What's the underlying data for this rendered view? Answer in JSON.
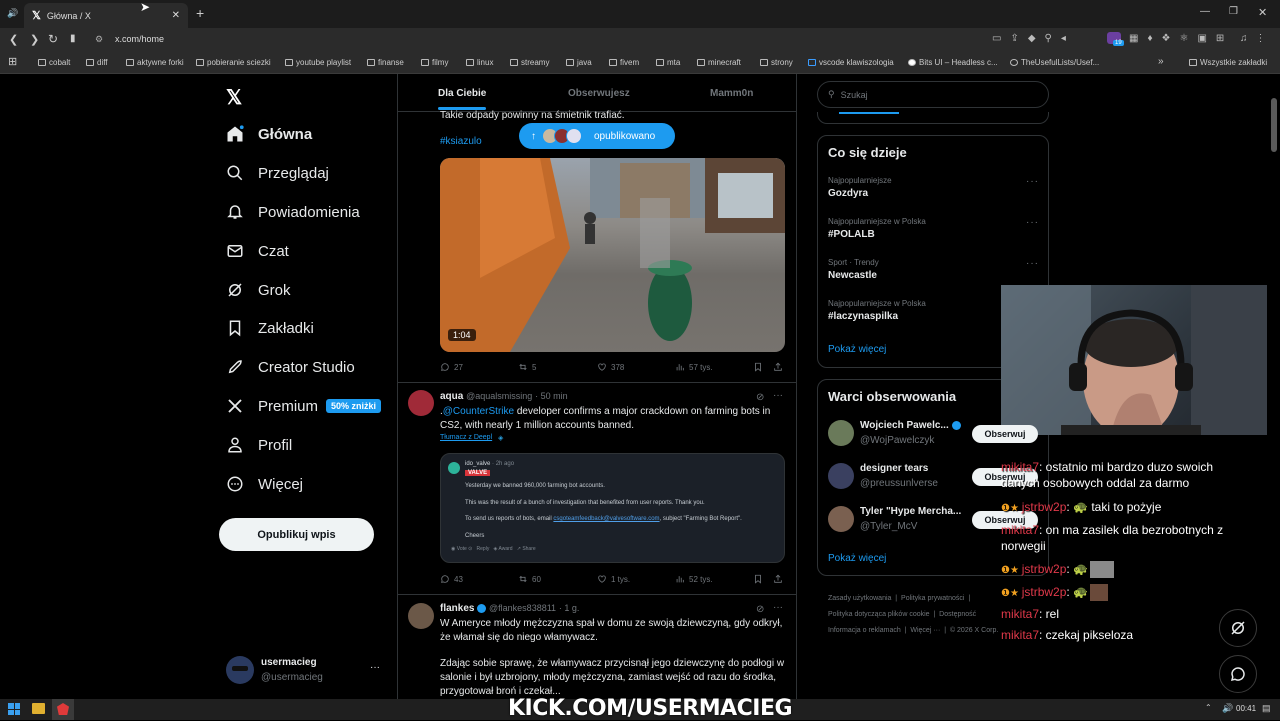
{
  "browser": {
    "tab_title": "Główna / X",
    "url": "x.com/home",
    "bookmarks": [
      "cobalt",
      "diff",
      "aktywne forki",
      "pobieranie sciezki",
      "youtube playlist",
      "finanse",
      "filmy",
      "linux",
      "streamy",
      "java",
      "fivem",
      "mta",
      "minecraft",
      "strony",
      "vscode klawiszologia",
      "Bits UI – Headless c...",
      "TheUsefulLists/Usef..."
    ],
    "all_bookmarks": "Wszystkie zakładki",
    "extension_badge": "19"
  },
  "sidebar": {
    "items": [
      {
        "label": "Główna",
        "icon": "home-icon"
      },
      {
        "label": "Przeglądaj",
        "icon": "search-icon"
      },
      {
        "label": "Powiadomienia",
        "icon": "bell-icon"
      },
      {
        "label": "Czat",
        "icon": "mail-icon"
      },
      {
        "label": "Grok",
        "icon": "grok-icon"
      },
      {
        "label": "Zakładki",
        "icon": "bookmark-icon"
      },
      {
        "label": "Creator Studio",
        "icon": "rocket-icon"
      },
      {
        "label": "Premium",
        "icon": "x-logo-icon"
      },
      {
        "label": "Profil",
        "icon": "person-icon"
      },
      {
        "label": "Więcej",
        "icon": "more-circle-icon"
      }
    ],
    "premium_badge": "50% zniżki",
    "post_button": "Opublikuj wpis",
    "user_name": "usermacieg",
    "user_handle": "@usermacieg"
  },
  "feed": {
    "tabs": [
      "Dla Ciebie",
      "Obserwujesz",
      "Mamm0n"
    ],
    "published_pill": "opublikowano",
    "post1": {
      "text": "Takie odpady powinny na śmietnik trafiać.",
      "hashtag": "#ksiazulo",
      "video_duration": "1:04",
      "replies": "27",
      "reposts": "5",
      "likes": "378",
      "views": "57 tys."
    },
    "post2": {
      "name": "aqua",
      "handle": "@aqualsmissing",
      "time": "· 50 min",
      "mention": "@CounterStrike",
      "text_prefix": ".",
      "text": " developer confirms a major crackdown on farming bots in CS2, with nearly 1 million accounts banned.",
      "translate": "Tłumacz z Deepl",
      "embed_user": "ido_valve",
      "embed_time": "· 2h ago",
      "embed_tag": "VALVE",
      "embed_line1": "Yesterday we banned 960,000 farming bot accounts.",
      "embed_line2": "This was the result of a bunch of investigation that benefited from user reports. Thank you.",
      "embed_line3a": "To send us reports of bots, email ",
      "embed_email": "csgoteamfeedback@valvesoftware.com",
      "embed_line3b": ", subject \"Farming Bot Report\".",
      "embed_line4": "Cheers",
      "embed_actions": [
        "Vote",
        "Reply",
        "Award",
        "Share"
      ],
      "replies": "43",
      "reposts": "60",
      "likes": "1 tys.",
      "views": "52 tys."
    },
    "post3": {
      "name": "flankes",
      "handle": "@flankes838811",
      "time": "· 1 g.",
      "text1": "W Ameryce młody mężczyzna spał w domu ze swoją dziewczyną, gdy odkrył, że włamał się do niego włamywacz.",
      "text2": "Zdając sobie sprawę, że włamywacz przycisnął jego dziewczynę do podłogi w salonie i był uzbrojony, młody mężczyzna, zamiast wejść od razu do środka, przygotował broń i czekał..."
    }
  },
  "right": {
    "search_placeholder": "Szukaj",
    "trends_title": "Co się dzieje",
    "trends": [
      {
        "cat": "Najpopularniejsze",
        "name": "Gozdyra"
      },
      {
        "cat": "Najpopularniejsze w Polska",
        "name": "#POLALB"
      },
      {
        "cat": "Sport · Trendy",
        "name": "Newcastle"
      },
      {
        "cat": "Najpopularniejsze w Polska",
        "name": "#laczynaspilka"
      }
    ],
    "show_more": "Pokaż więcej",
    "who_title": "Warci obserwowania",
    "who": [
      {
        "name": "Wojciech Pawelc...",
        "handle": "@WojPawelczyk"
      },
      {
        "name": "designer tears",
        "handle": "@preussunlverse"
      },
      {
        "name": "Tyler \"Hype Mercha...",
        "handle": "@Tyler_McV"
      }
    ],
    "follow": "Obserwuj",
    "footer": [
      "Zasady użytkowania",
      "Polityka prywatności",
      "Polityka dotycząca plików cookie",
      "Dostępność",
      "Informacja o reklamach",
      "Więcej ···",
      "© 2026 X Corp."
    ]
  },
  "overlay": {
    "chat": [
      {
        "user": "mikita7",
        "text": ": ostatnio mi bardzo duzo swoich danych osobowych oddal za darmo",
        "badges": false
      },
      {
        "user": "jstrbw2p",
        "text": ": 🐢 taki to pożyje",
        "badges": true
      },
      {
        "user": "mikita7",
        "text": ": on ma zasilek dla bezrobotnych z norwegii",
        "badges": false
      },
      {
        "user": "jstrbw2p",
        "text": ": 🐢",
        "badges": true
      },
      {
        "user": "jstrbw2p",
        "text": ": 🐢",
        "badges": true
      },
      {
        "user": "mikita7",
        "text": ": rel",
        "badges": false
      },
      {
        "user": "mikita7",
        "text": ": czekaj pikseloza",
        "badges": false
      }
    ],
    "kick_banner": "KICK.COM/USERMACIEG"
  },
  "taskbar": {
    "clock": "00:41"
  },
  "colors": {
    "accent": "#1d9bf0",
    "chat_user": "#e0394a",
    "kick_green": "#53fc18"
  }
}
